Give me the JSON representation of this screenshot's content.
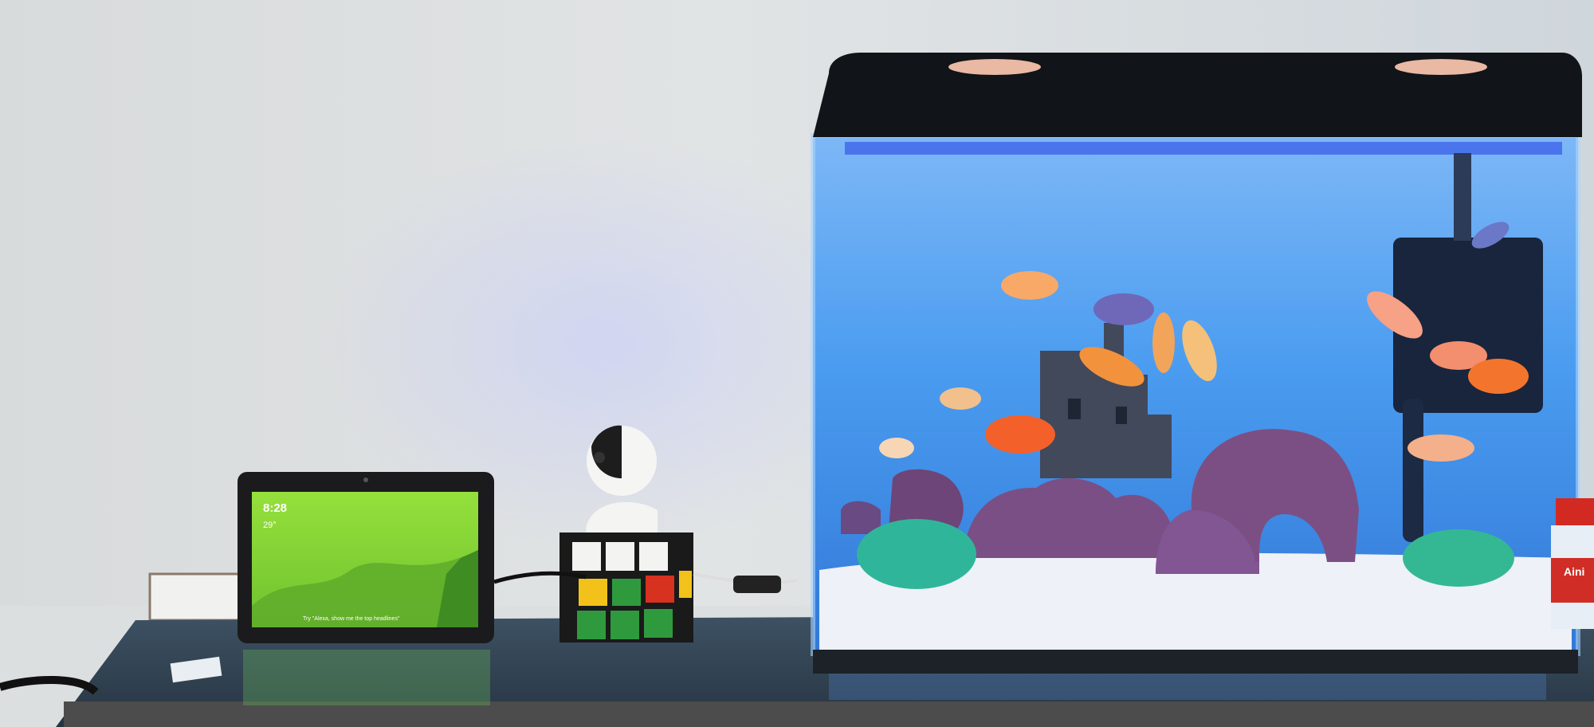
{
  "smart_display": {
    "clock": "8:28",
    "weather": "29°",
    "hint": "Try \"Alexa, show me the top headlines\""
  },
  "jar": {
    "label": "Aini"
  },
  "colors": {
    "wall": "#dde0e1",
    "water": "#3f8fe6",
    "water_light": "#8cc4fb",
    "table": "#2e3c4a",
    "display_screen": "#8fdc3a",
    "rock": "#7c4f84",
    "plant": "#2fb69a",
    "fish_orange": "#f46a2a"
  }
}
